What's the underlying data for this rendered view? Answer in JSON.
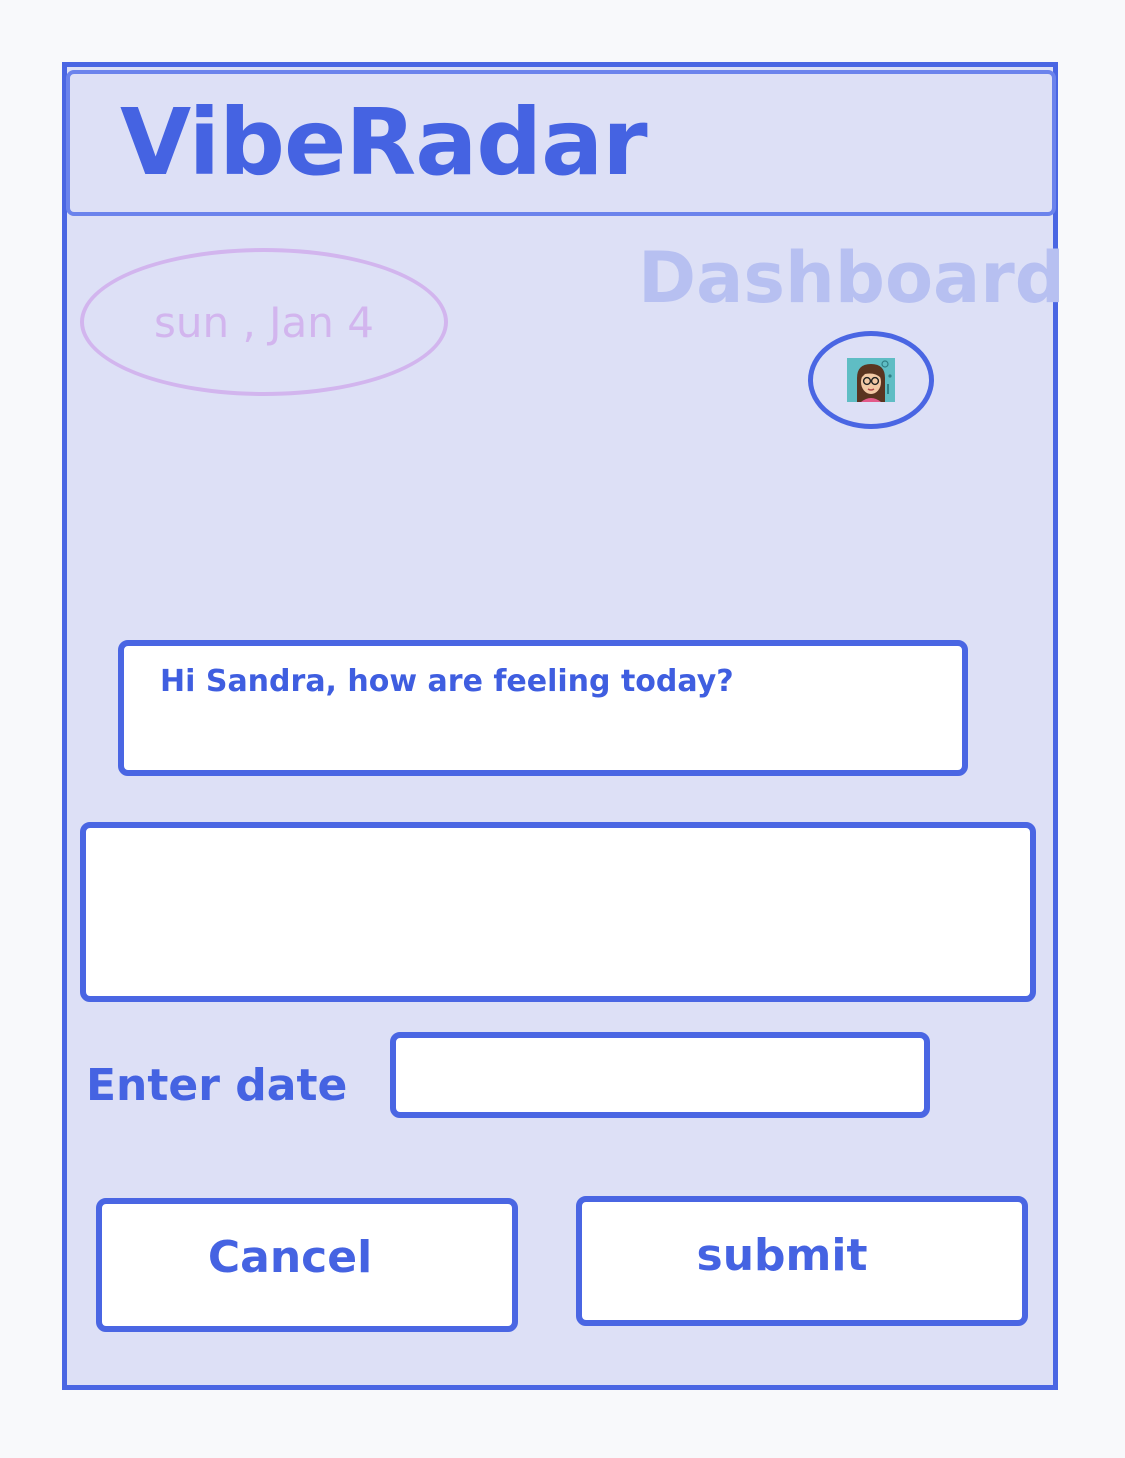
{
  "app": {
    "title": "VibeRadar"
  },
  "header": {
    "date": "sun , Jan 4",
    "page_title": "Dashboard",
    "avatar_icon": "user-avatar-icon"
  },
  "prompt": {
    "greeting": "Hi Sandra, how are feeling today?"
  },
  "response": {
    "value": ""
  },
  "date_field": {
    "label": "Enter date",
    "value": ""
  },
  "actions": {
    "cancel_label": "Cancel",
    "submit_label": "submit"
  },
  "colors": {
    "accent": "#4a66e3",
    "panel": "#dde0f6",
    "date_badge": "#d2b5ee",
    "muted_title": "#b7c0f1"
  }
}
